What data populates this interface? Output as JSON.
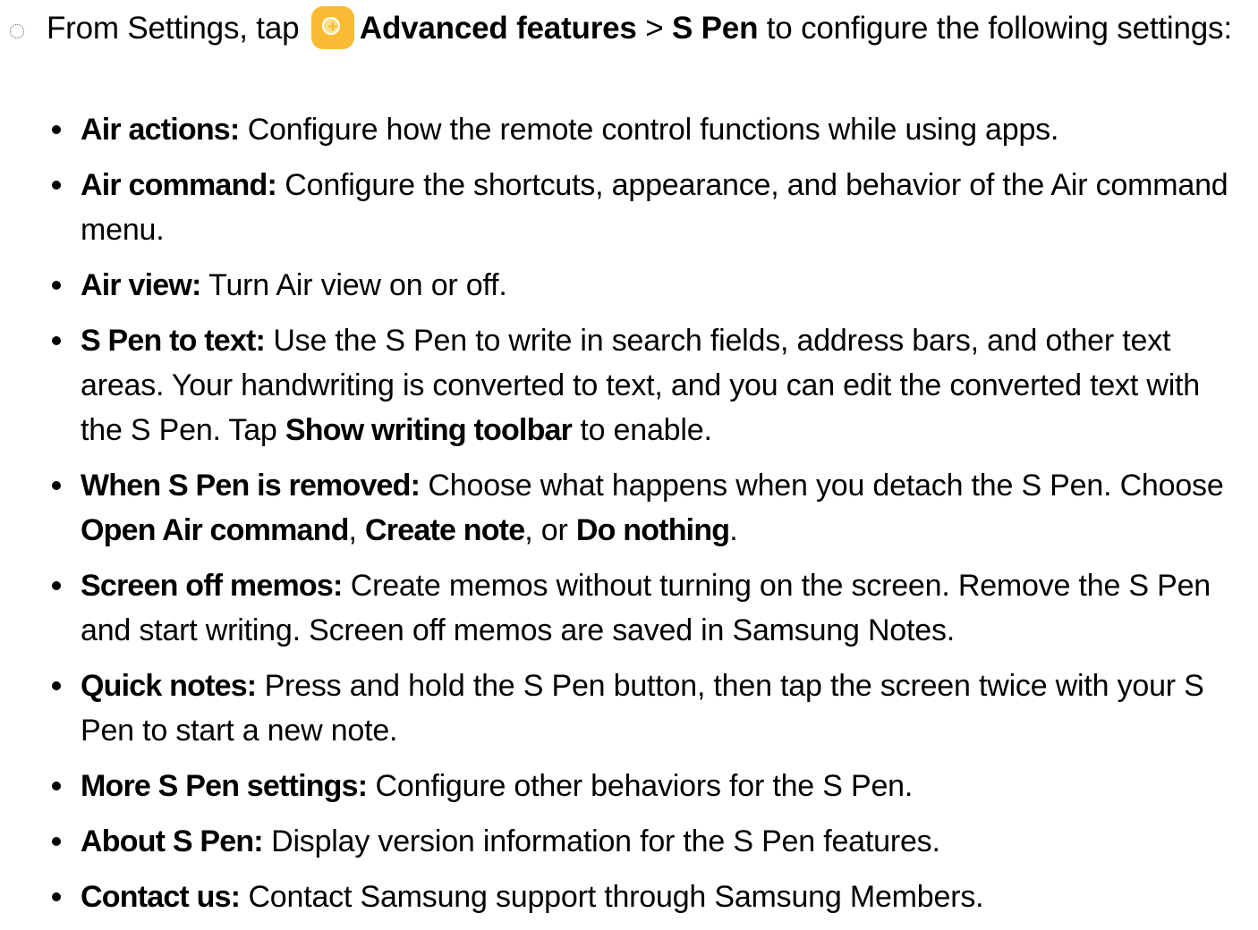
{
  "intro": {
    "prefix": "From Settings, tap",
    "icon": "settings-gear-icon",
    "path_1": "Advanced features",
    "separator": ">",
    "path_2": "S Pen",
    "suffix": "to configure the following settings:"
  },
  "features": [
    {
      "term": "Air actions:",
      "desc": "Configure how the remote control functions while using apps."
    },
    {
      "term": "Air command:",
      "desc": "Configure the shortcuts, appearance, and behavior of the Air command menu."
    },
    {
      "term": "Air view:",
      "desc": "Turn Air view on or off."
    },
    {
      "term": "S Pen to text:",
      "desc": "Use the S Pen to write in search fields, address bars, and other text areas. Your handwriting is converted to text, and you can edit the converted text with the S Pen. Tap",
      "b1": "Show writing toolbar",
      "t1": "to enable."
    },
    {
      "term": "When S Pen is removed:",
      "desc": "Choose what happens when you detach the S Pen. Choose",
      "b1": "Open Air command",
      "t1": ",",
      "b2": "Create note",
      "t2": ", or",
      "b3": "Do nothing",
      "t3": "."
    },
    {
      "term": "Screen off memos:",
      "desc": "Create memos without turning on the screen. Remove the S Pen and start writing. Screen off memos are saved in Samsung Notes."
    },
    {
      "term": "Quick notes:",
      "desc": "Press and hold the S Pen button, then tap the screen twice with your S Pen to start a new note."
    },
    {
      "term": "More S Pen settings:",
      "desc": "Configure other behaviors for the S Pen."
    },
    {
      "term": "About S Pen:",
      "desc": "Display version information for the S Pen features."
    },
    {
      "term": "Contact us:",
      "desc": "Contact Samsung support through Samsung Members."
    }
  ],
  "colors": {
    "icon_background": "#f9bb34",
    "text": "#000000"
  }
}
